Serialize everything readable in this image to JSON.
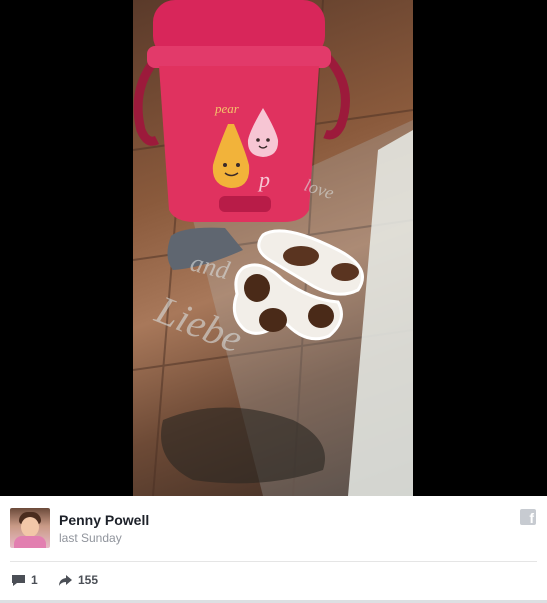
{
  "post": {
    "author_name": "Penny Powell",
    "timestamp": "last Sunday",
    "comment_count": "1",
    "share_count": "155"
  },
  "icons": {
    "platform": "facebook-icon",
    "comment": "comment-icon",
    "share": "share-icon"
  },
  "colors": {
    "author_name": "#1d2129",
    "timestamp": "#90949c",
    "stats": "#4b4f56"
  }
}
